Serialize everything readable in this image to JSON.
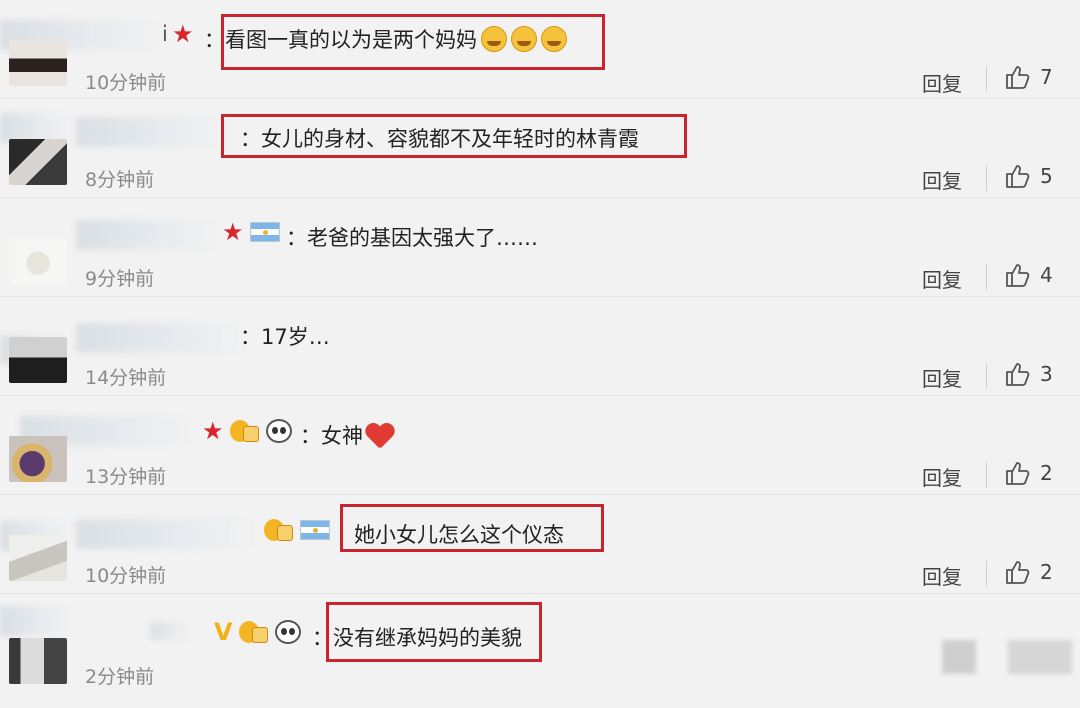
{
  "comments": [
    {
      "name_suffix": "i",
      "text": "看图一真的以为是两个妈妈",
      "time": "10分钟前",
      "reply": "回复",
      "likes": "7",
      "badges": [
        "red-star"
      ],
      "emojis": [
        "laughing-crying-emoji",
        "laughing-crying-emoji",
        "laughing-crying-emoji"
      ],
      "highlighted": true
    },
    {
      "name_suffix": "",
      "text": "女儿的身材、容貌都不及年轻时的林青霞",
      "time": "8分钟前",
      "reply": "回复",
      "likes": "5",
      "badges": [],
      "highlighted": true
    },
    {
      "name_suffix": "",
      "text": "老爸的基因太强大了……",
      "time": "9分钟前",
      "reply": "回复",
      "likes": "4",
      "badges": [
        "red-star",
        "argentina-flag"
      ],
      "highlighted": false
    },
    {
      "name_suffix": "",
      "text": "17岁…",
      "time": "14分钟前",
      "reply": "回复",
      "likes": "3",
      "badges": [],
      "highlighted": false
    },
    {
      "name_suffix": "",
      "text": "女神",
      "time": "13分钟前",
      "reply": "回复",
      "likes": "2",
      "badges": [
        "red-star",
        "crown-badge",
        "panda"
      ],
      "emojis": [
        "red-heart"
      ],
      "highlighted": false
    },
    {
      "name_suffix": "",
      "text": "她小女儿怎么这个仪态",
      "time": "10分钟前",
      "reply": "回复",
      "likes": "2",
      "badges": [
        "crown-badge",
        "argentina-flag"
      ],
      "highlighted": true
    },
    {
      "name_suffix": "",
      "text": "没有继承妈妈的美貌",
      "time": "2分钟前",
      "reply": "",
      "likes": "",
      "badges": [
        "vip-v",
        "crown-badge",
        "panda"
      ],
      "highlighted": true
    }
  ],
  "separator": "：",
  "colors": {
    "highlight": "#c9252e",
    "star": "#d8262c",
    "vip": "#f1b117",
    "time": "#8a8a8a",
    "background": "#f2f2f2"
  }
}
